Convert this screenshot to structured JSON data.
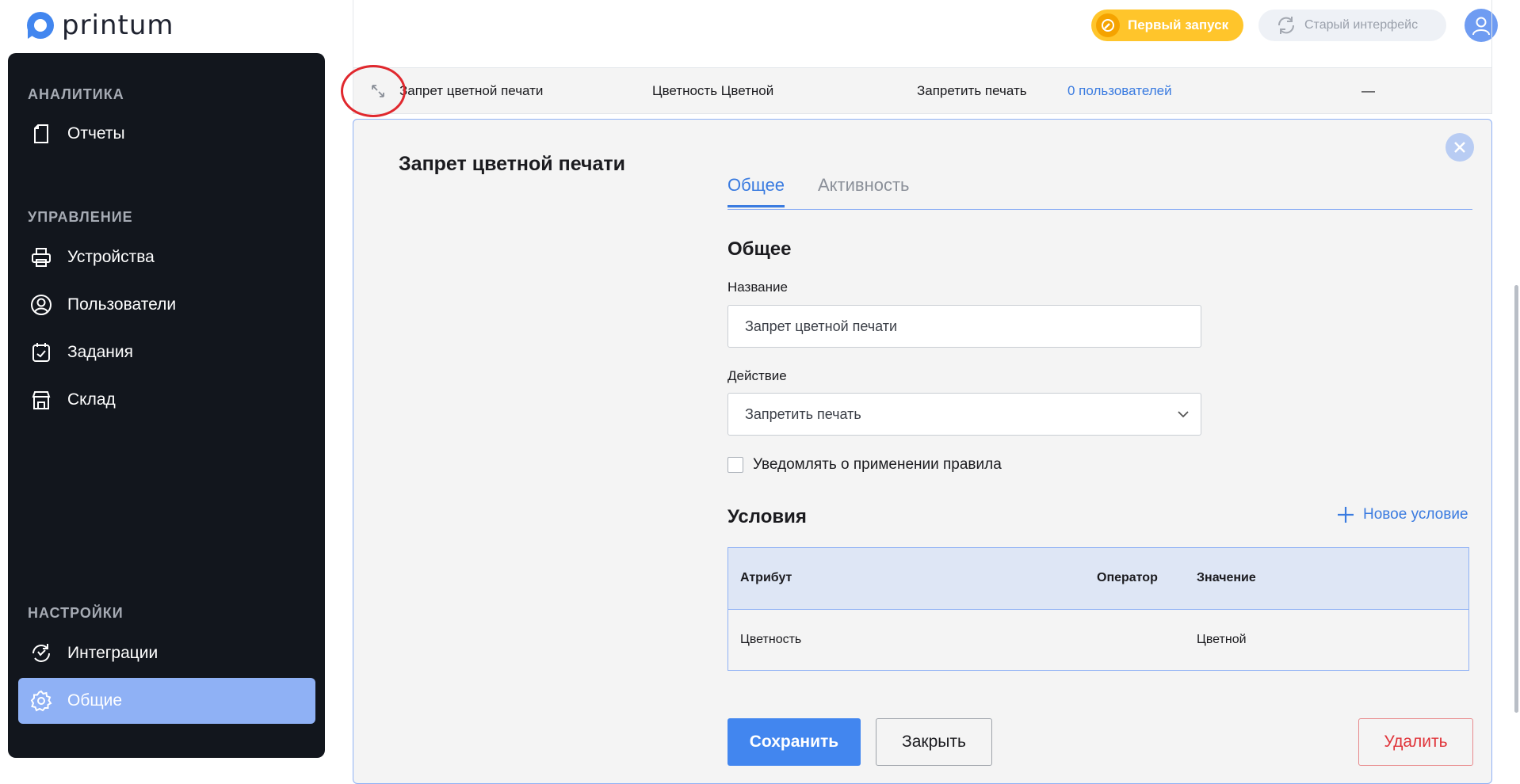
{
  "app": {
    "logo_text": "printum"
  },
  "header": {
    "first_run_label": "Первый запуск",
    "old_ui_label": "Старый интерфейс"
  },
  "sidebar": {
    "sections": [
      {
        "title": "АНАЛИТИКА",
        "items": [
          {
            "label": "Отчеты",
            "icon": "report-icon"
          }
        ]
      },
      {
        "title": "УПРАВЛЕНИЕ",
        "items": [
          {
            "label": "Устройства",
            "icon": "printer-icon"
          },
          {
            "label": "Пользователи",
            "icon": "user-icon"
          },
          {
            "label": "Задания",
            "icon": "tasks-icon"
          },
          {
            "label": "Склад",
            "icon": "warehouse-icon"
          }
        ]
      },
      {
        "title": "НАСТРОЙКИ",
        "items": [
          {
            "label": "Интеграции",
            "icon": "sync-icon"
          },
          {
            "label": "Общие",
            "icon": "gear-icon",
            "active": true
          }
        ]
      }
    ]
  },
  "rule_row": {
    "name": "Запрет цветной печати",
    "condition": "Цветность Цветной",
    "action": "Запретить печать",
    "users": "0 пользователей",
    "extra": "—"
  },
  "panel": {
    "title": "Запрет цветной печати",
    "tabs": [
      {
        "label": "Общее",
        "active": true
      },
      {
        "label": "Активность",
        "active": false
      }
    ],
    "general_heading": "Общее",
    "name_label": "Название",
    "name_value": "Запрет цветной печати",
    "action_label": "Действие",
    "action_value": "Запретить печать",
    "notify_label": "Уведомлять о применении правила",
    "notify_checked": false,
    "conditions_heading": "Условия",
    "new_condition_label": "Новое условие",
    "conditions_table": {
      "headers": [
        "Атрибут",
        "Оператор",
        "Значение"
      ],
      "rows": [
        [
          "Цветность",
          "",
          "Цветной"
        ]
      ]
    },
    "buttons": {
      "save": "Сохранить",
      "close": "Закрыть",
      "delete": "Удалить"
    }
  },
  "colors": {
    "accent": "#3a7be0",
    "sidebar_bg": "#12161d",
    "sidebar_active": "#8fb1f5",
    "first_run": "#ffc52b",
    "delete": "#e0343a"
  }
}
